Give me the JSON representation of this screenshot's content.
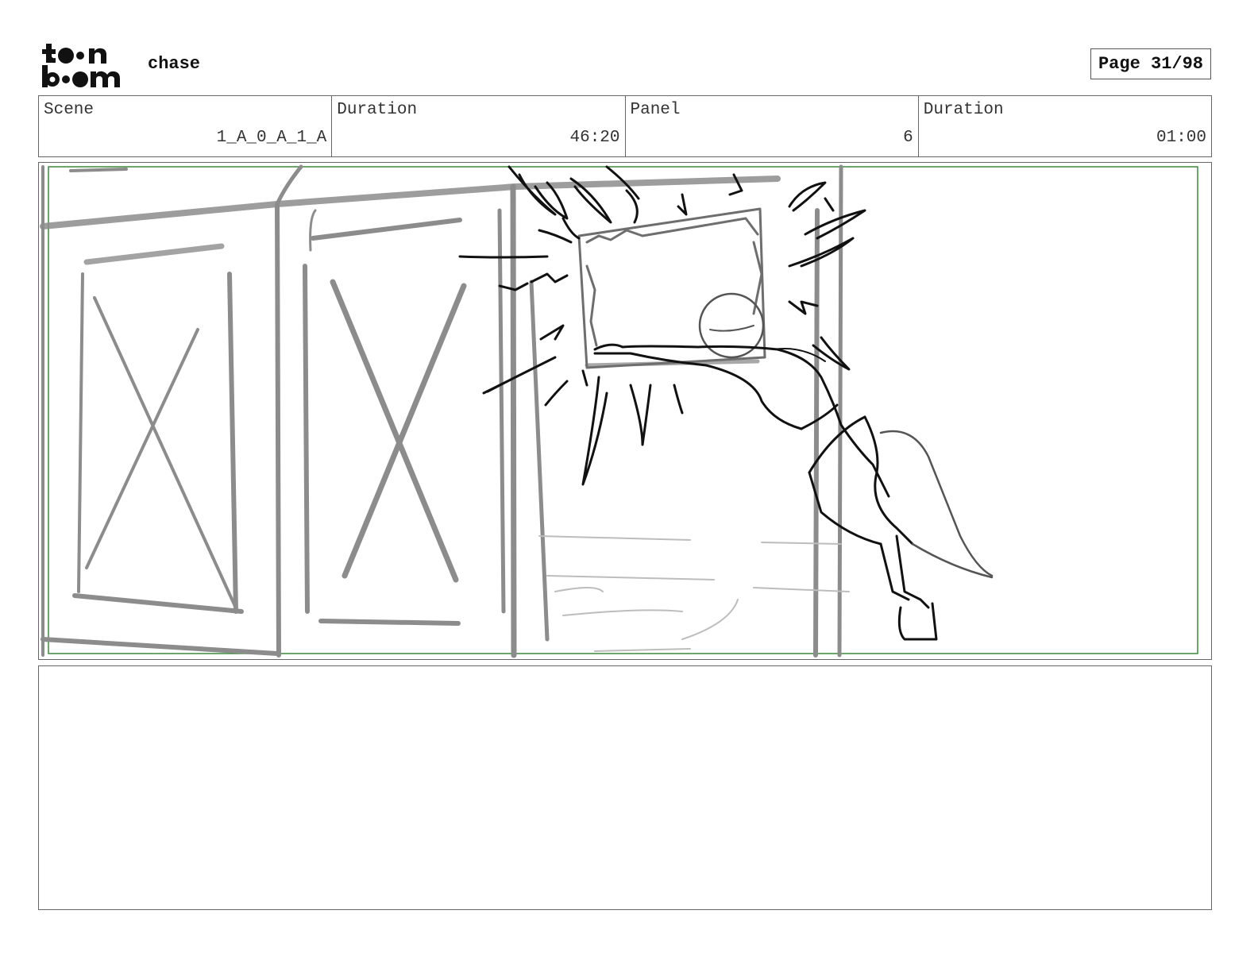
{
  "header": {
    "logo_text": "toon boom",
    "project_title": "chase",
    "page_label": "Page 31/98"
  },
  "info": {
    "scene_label": "Scene",
    "scene_value": "1_A_0_A_1_A",
    "scene_duration_label": "Duration",
    "scene_duration_value": "46:20",
    "panel_label": "Panel",
    "panel_value": "6",
    "panel_duration_label": "Duration",
    "panel_duration_value": "01:00"
  },
  "panel": {
    "safe_frame_color": "#3a8a3a"
  },
  "notes": {
    "text": ""
  }
}
